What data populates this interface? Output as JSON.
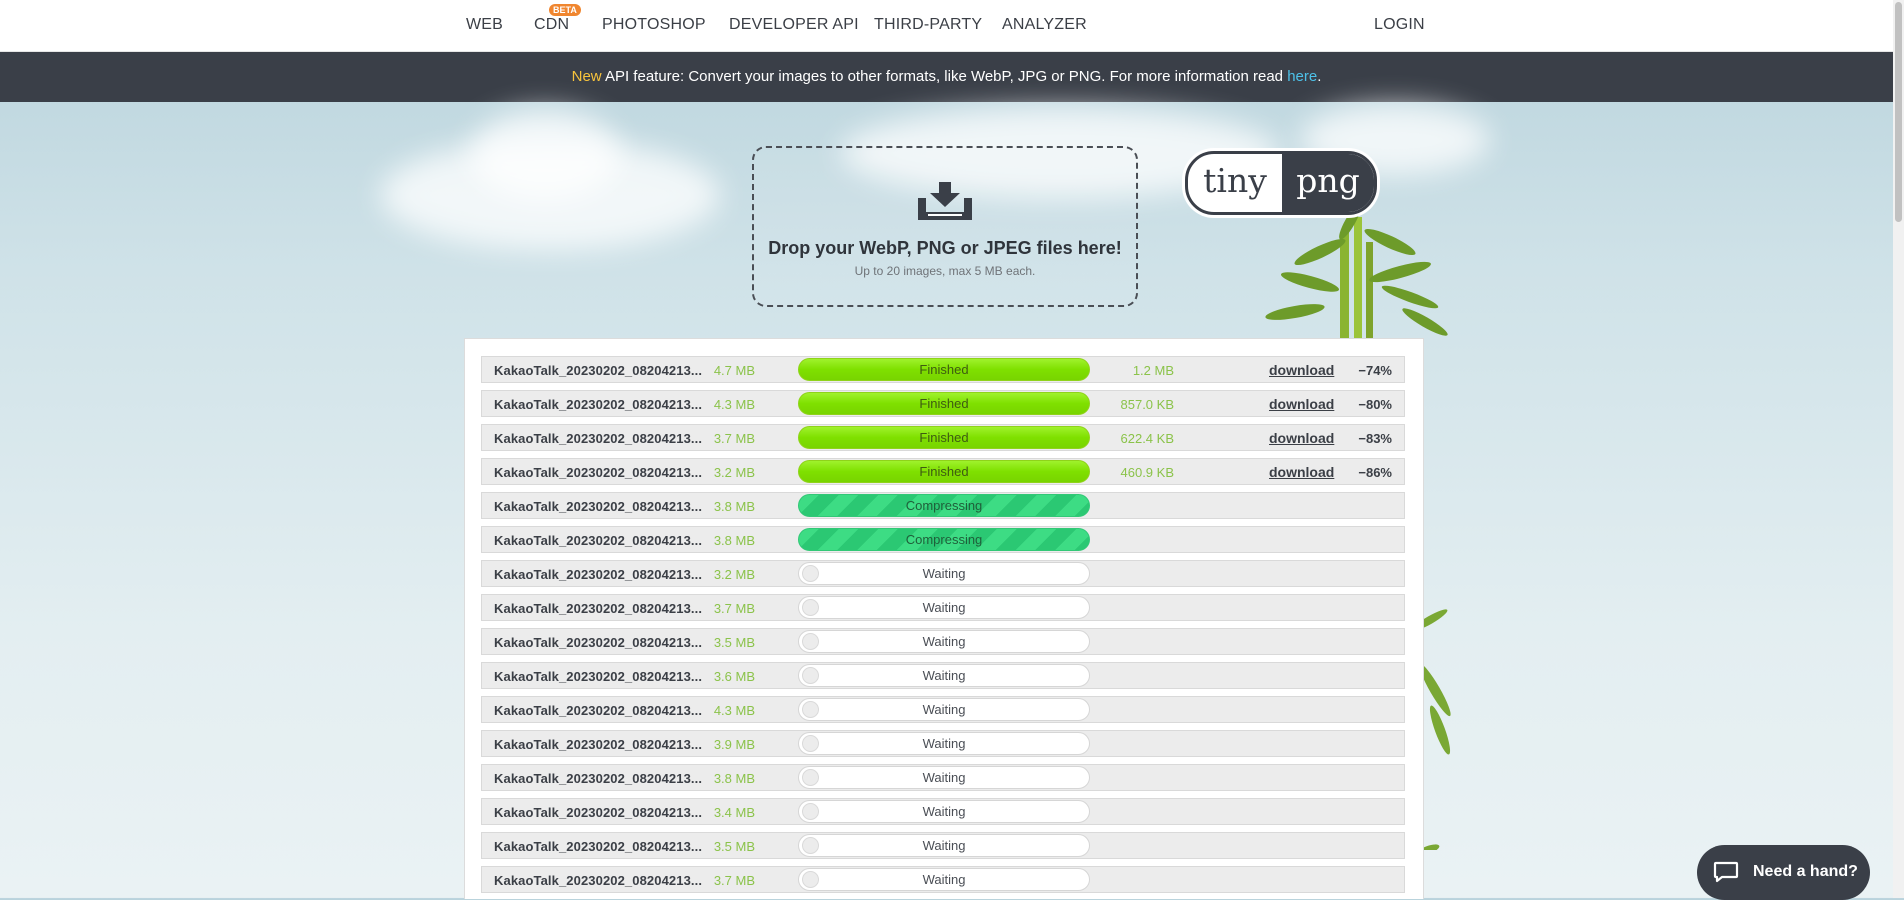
{
  "nav": {
    "items": [
      "WEB",
      "CDN",
      "PHOTOSHOP",
      "DEVELOPER API",
      "THIRD-PARTY",
      "ANALYZER"
    ],
    "beta_badge": "BETA",
    "login": "LOGIN"
  },
  "banner": {
    "new_label": "New",
    "text": " API feature: Convert your images to other formats, like WebP, JPG or PNG. For more information read ",
    "link": "here",
    "end": "."
  },
  "dropzone": {
    "title": "Drop your WebP, PNG or JPEG files here!",
    "subtitle": "Up to 20 images, max 5 MB each."
  },
  "logo": {
    "left": "tiny",
    "right": "png"
  },
  "files": [
    {
      "name": "KakaoTalk_20230202_08204213...",
      "size": "4.7 MB",
      "status": "Finished",
      "out_size": "1.2 MB",
      "download": "download",
      "saving": "−74%"
    },
    {
      "name": "KakaoTalk_20230202_08204213...",
      "size": "4.3 MB",
      "status": "Finished",
      "out_size": "857.0 KB",
      "download": "download",
      "saving": "−80%"
    },
    {
      "name": "KakaoTalk_20230202_08204213...",
      "size": "3.7 MB",
      "status": "Finished",
      "out_size": "622.4 KB",
      "download": "download",
      "saving": "−83%"
    },
    {
      "name": "KakaoTalk_20230202_08204213...",
      "size": "3.2 MB",
      "status": "Finished",
      "out_size": "460.9 KB",
      "download": "download",
      "saving": "−86%"
    },
    {
      "name": "KakaoTalk_20230202_08204213...",
      "size": "3.8 MB",
      "status": "Compressing"
    },
    {
      "name": "KakaoTalk_20230202_08204213...",
      "size": "3.8 MB",
      "status": "Compressing"
    },
    {
      "name": "KakaoTalk_20230202_08204213...",
      "size": "3.2 MB",
      "status": "Waiting"
    },
    {
      "name": "KakaoTalk_20230202_08204213...",
      "size": "3.7 MB",
      "status": "Waiting"
    },
    {
      "name": "KakaoTalk_20230202_08204213...",
      "size": "3.5 MB",
      "status": "Waiting"
    },
    {
      "name": "KakaoTalk_20230202_08204213...",
      "size": "3.6 MB",
      "status": "Waiting"
    },
    {
      "name": "KakaoTalk_20230202_08204213...",
      "size": "4.3 MB",
      "status": "Waiting"
    },
    {
      "name": "KakaoTalk_20230202_08204213...",
      "size": "3.9 MB",
      "status": "Waiting"
    },
    {
      "name": "KakaoTalk_20230202_08204213...",
      "size": "3.8 MB",
      "status": "Waiting"
    },
    {
      "name": "KakaoTalk_20230202_08204213...",
      "size": "3.4 MB",
      "status": "Waiting"
    },
    {
      "name": "KakaoTalk_20230202_08204213...",
      "size": "3.5 MB",
      "status": "Waiting"
    },
    {
      "name": "KakaoTalk_20230202_08204213...",
      "size": "3.7 MB",
      "status": "Waiting"
    }
  ],
  "help": {
    "label": "Need a hand?"
  },
  "colors": {
    "dark": "#3a3f48",
    "accent_yellow": "#f7c33c",
    "link_blue": "#4dc1e8",
    "size_green": "#8bc34a",
    "finished_green": "#7fe000",
    "compressing_green": "#3ddc84",
    "beta_orange": "#f0862f"
  },
  "icons": {
    "dropzone": "download-tray-icon",
    "help": "chat-bubble-icon"
  }
}
